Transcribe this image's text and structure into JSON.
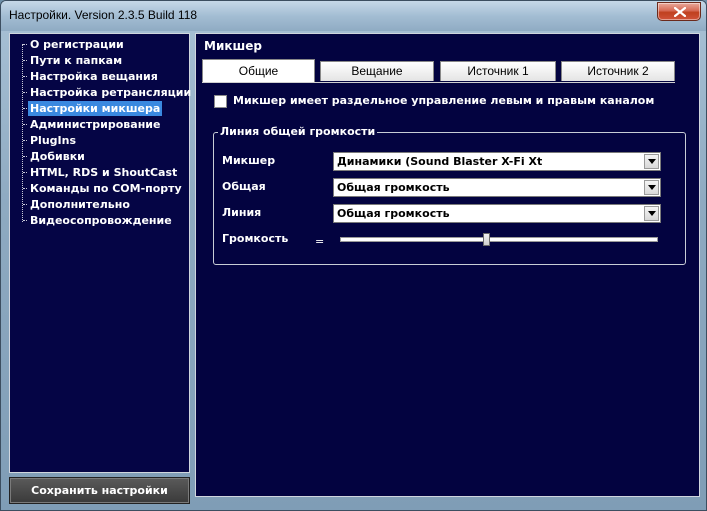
{
  "window": {
    "title": "Настройки. Version 2.3.5 Build 118"
  },
  "sidebar": {
    "items": [
      {
        "label": "О регистрации"
      },
      {
        "label": "Пути к папкам"
      },
      {
        "label": "Настройка вещания"
      },
      {
        "label": "Настройка ретрансляции"
      },
      {
        "label": "Настройки микшера",
        "selected": true
      },
      {
        "label": "Администрирование"
      },
      {
        "label": "PlugIns"
      },
      {
        "label": "Добивки"
      },
      {
        "label": "HTML, RDS и ShoutCast"
      },
      {
        "label": "Команды по COM-порту"
      },
      {
        "label": "Дополнительно"
      },
      {
        "label": "Видеосопровождение"
      }
    ],
    "selected_color": "#3a89e0",
    "background_color": "#050545"
  },
  "save_button": {
    "label": "Сохранить настройки"
  },
  "main": {
    "section_title": "Микшер",
    "tabs": [
      {
        "label": "Общие",
        "active": true
      },
      {
        "label": "Вещание"
      },
      {
        "label": "Источник 1"
      },
      {
        "label": "Источник 2"
      }
    ],
    "separate_channels": {
      "label": "Микшер имеет раздельное управление левым и правым каналом",
      "checked": false
    },
    "volume_group": {
      "title": "Линия общей громкости",
      "mixer": {
        "label": "Микшер",
        "value": "Динамики (Sound Blaster X-Fi Xt"
      },
      "general": {
        "label": "Общая",
        "value": "Общая громкость"
      },
      "line": {
        "label": "Линия",
        "value": "Общая громкость"
      },
      "volume": {
        "label": "Громкость",
        "sign": "=",
        "level": 0.46
      }
    }
  },
  "icons": {
    "close": "close-x-icon",
    "dropdown": "chevron-down-icon"
  }
}
